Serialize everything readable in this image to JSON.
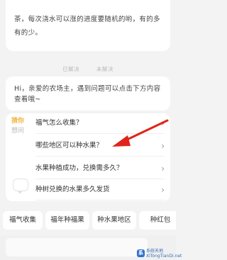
{
  "message": {
    "text": "茶，每次浇水可以涨的进度要随机的哟，有的多有的少。"
  },
  "meta": {
    "left": "已解决",
    "right": "未解决"
  },
  "greeting": {
    "text": "Hi，亲爱的农场主，遇到问题可以点击下方内容查看哦~"
  },
  "faq": {
    "side_title_accent": "猜你",
    "side_title_rest": "想问",
    "items": [
      {
        "label": "福气怎么收集？"
      },
      {
        "label": "哪些地区可以种水果？"
      },
      {
        "label": "水果种植成功，兑换需多久？"
      },
      {
        "label": "种树兑换的水果多久发货"
      }
    ],
    "chevron": "›"
  },
  "chips": [
    {
      "label": "福气收集"
    },
    {
      "label": "福年种福果"
    },
    {
      "label": "种水果地区"
    },
    {
      "label": "种红包"
    }
  ],
  "annotation": {
    "arrow_color": "#e0241b"
  },
  "watermark": {
    "logo": "系",
    "line1": "系统天地",
    "line2": "XiTongTianDi.net"
  }
}
